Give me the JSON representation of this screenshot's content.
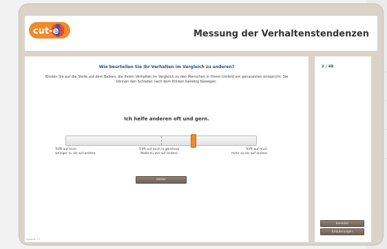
{
  "header": {
    "logo_text": "cut-e",
    "title": "Messung der Verhaltenstendenzen"
  },
  "question": {
    "title": "Wie beurteilen Sie Ihr Verhalten im Vergleich zu anderen?",
    "instruction": "Klicken Sie auf die Stelle auf dem Balken, die Ihrem Verhalten im Vergleich zu den Menschen in Ihrem Umfeld am genauesten entspricht. Sie können den Schieber nach dem Klicken beliebig bewegen.",
    "statement": "Ich helfe anderen oft und gern."
  },
  "slider": {
    "value": 0.67,
    "midpoint": 0.5,
    "handle_color": "#f08a2a",
    "labels": {
      "left_line1": "Trifft auf mich",
      "left_line2": "weniger zu als auf andere",
      "mid_line1": "Trifft auf mich in gleichem",
      "mid_line2": "Maße zu wie auf andere",
      "right_line1": "Trifft auf mich",
      "right_line2": "mehr zu als auf andere"
    }
  },
  "buttons": {
    "weiter": "weiter",
    "beenden": "beenden",
    "erlaeuterungen": "Erläuterungen"
  },
  "sidebar": {
    "progress": "2 / 48"
  },
  "footer": {
    "version": "squares 7.1"
  },
  "colors": {
    "accent": "#2a4c7f",
    "brand_orange": "#f08a2a",
    "frame": "#d9d3c9",
    "button": "#7d7266"
  }
}
